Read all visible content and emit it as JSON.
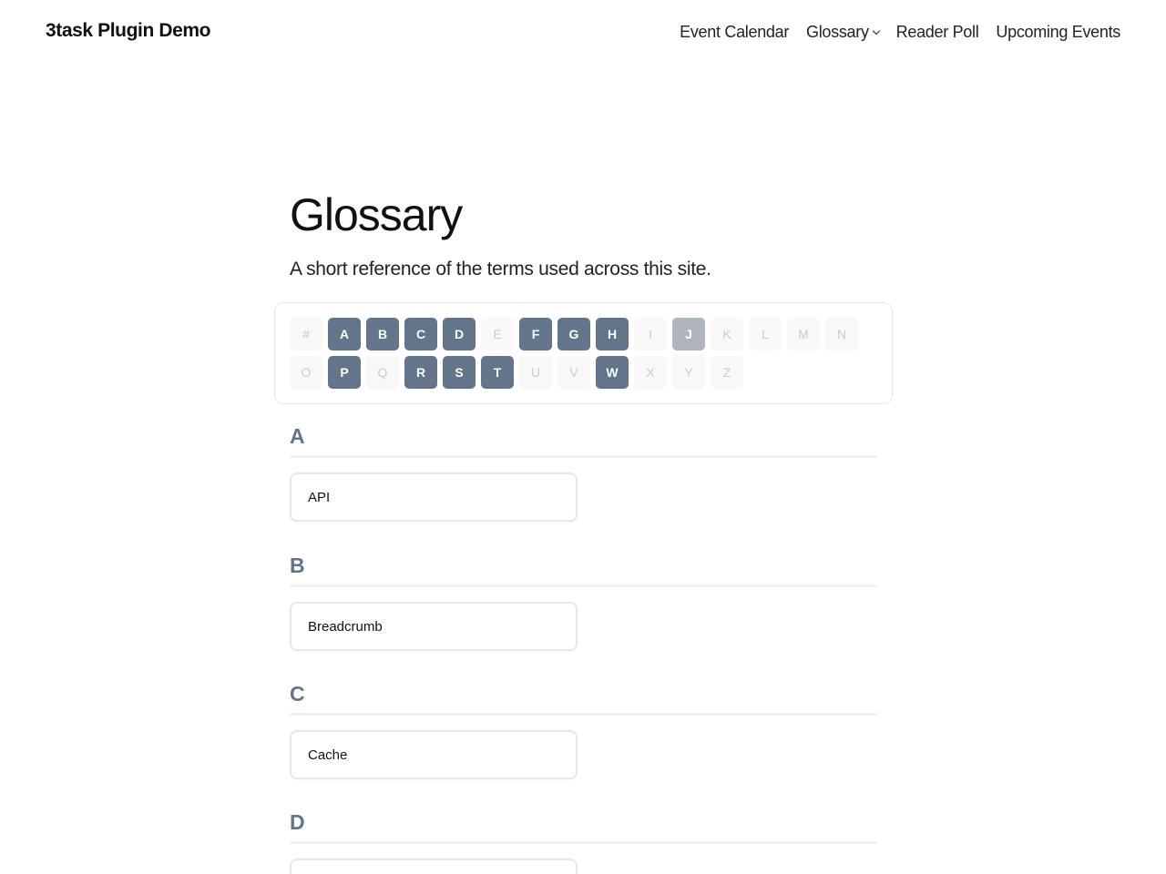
{
  "site": {
    "title": "3task Plugin Demo"
  },
  "nav": {
    "items": [
      "Event Calendar",
      "Glossary",
      "Reader Poll",
      "Upcoming Events"
    ]
  },
  "page": {
    "title": "Glossary",
    "description": "A short reference of the terms used across this site."
  },
  "letters": {
    "row1": [
      {
        "label": "#",
        "state": "inactive"
      },
      {
        "label": "A",
        "state": "active"
      },
      {
        "label": "B",
        "state": "active"
      },
      {
        "label": "C",
        "state": "active"
      },
      {
        "label": "D",
        "state": "active"
      },
      {
        "label": "E",
        "state": "inactive"
      },
      {
        "label": "F",
        "state": "active"
      },
      {
        "label": "G",
        "state": "active"
      },
      {
        "label": "H",
        "state": "active"
      },
      {
        "label": "I",
        "state": "inactive"
      },
      {
        "label": "J",
        "state": "current"
      },
      {
        "label": "K",
        "state": "inactive"
      },
      {
        "label": "L",
        "state": "inactive"
      },
      {
        "label": "M",
        "state": "inactive"
      },
      {
        "label": "N",
        "state": "inactive"
      }
    ],
    "row2": [
      {
        "label": "O",
        "state": "inactive"
      },
      {
        "label": "P",
        "state": "active"
      },
      {
        "label": "Q",
        "state": "inactive"
      },
      {
        "label": "R",
        "state": "active"
      },
      {
        "label": "S",
        "state": "active"
      },
      {
        "label": "T",
        "state": "active"
      },
      {
        "label": "U",
        "state": "inactive"
      },
      {
        "label": "V",
        "state": "inactive"
      },
      {
        "label": "W",
        "state": "active"
      },
      {
        "label": "X",
        "state": "inactive"
      },
      {
        "label": "Y",
        "state": "inactive"
      },
      {
        "label": "Z",
        "state": "inactive"
      }
    ]
  },
  "sections": [
    {
      "letter": "A",
      "term": "API"
    },
    {
      "letter": "B",
      "term": "Breadcrumb"
    },
    {
      "letter": "C",
      "term": "Cache"
    },
    {
      "letter": "D",
      "term": ""
    }
  ],
  "colors": {
    "accent": "#64748b",
    "letter_inactive_bg": "#f8f8f8",
    "letter_current_bg": "#aeb5bf"
  }
}
